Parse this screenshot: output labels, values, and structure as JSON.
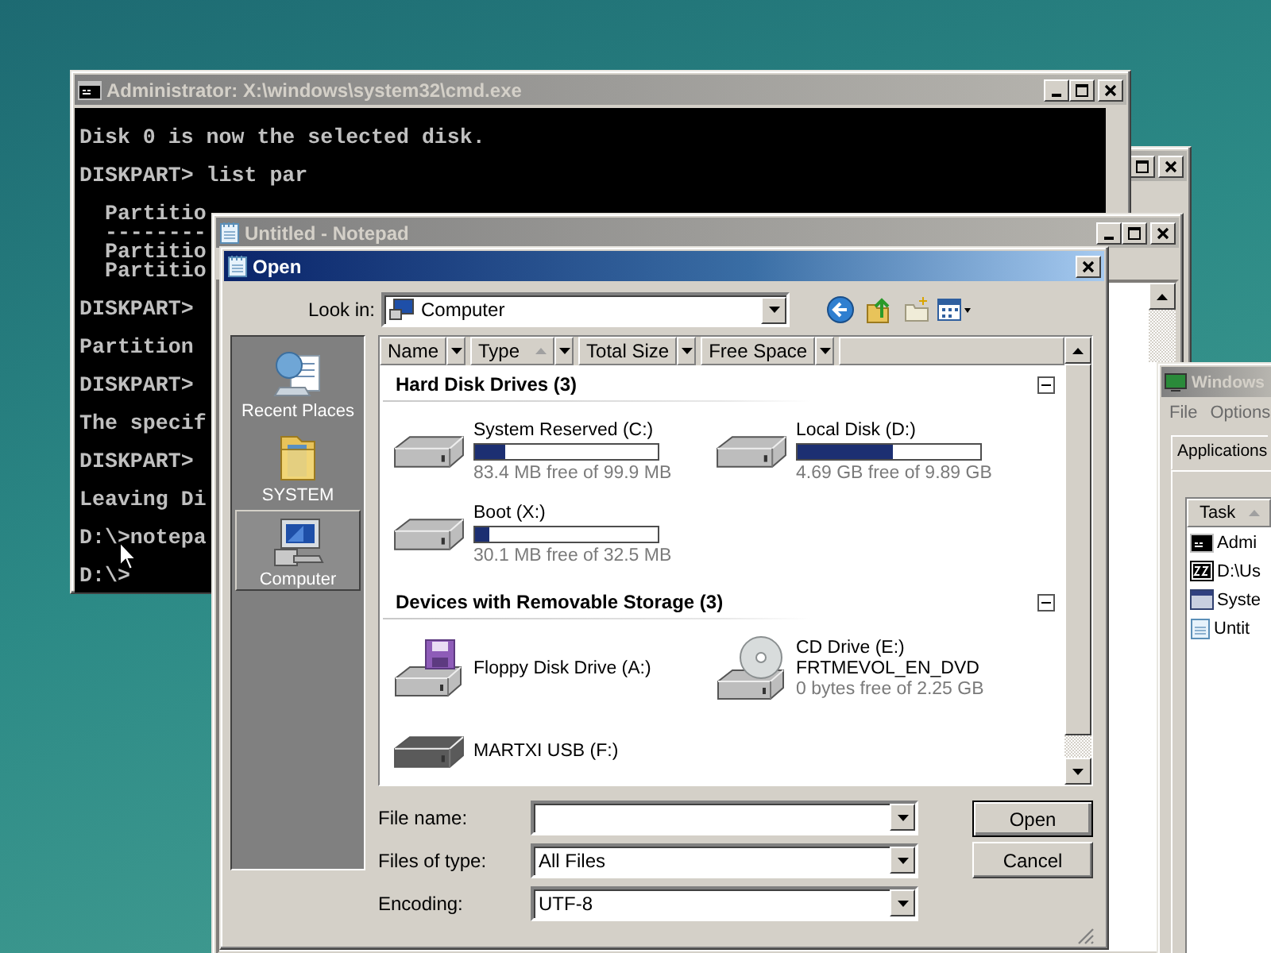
{
  "background_window": {
    "active": false
  },
  "console_window": {
    "title": "Administrator: X:\\windows\\system32\\cmd.exe",
    "active": false,
    "blocks": [
      [
        "Disk 0 is now the selected disk."
      ],
      [
        "DISKPART> list par"
      ],
      [
        "  Partitio",
        "  --------",
        "  Partitio",
        "  Partitio"
      ],
      [
        "DISKPART>"
      ],
      [
        "Partition"
      ],
      [
        "DISKPART>"
      ],
      [
        "The specif"
      ],
      [
        "DISKPART>"
      ],
      [
        "Leaving Di"
      ],
      [
        "D:\\>notepa"
      ],
      [
        "D:\\>"
      ]
    ]
  },
  "notepad_window": {
    "title": "Untitled - Notepad",
    "active": false
  },
  "open_dialog": {
    "title": "Open",
    "active": true,
    "look_in": {
      "label": "Look in:",
      "value": "Computer"
    },
    "places": [
      {
        "label": "Recent Places",
        "kind": "recent",
        "selected": false
      },
      {
        "label": "SYSTEM",
        "kind": "folder",
        "selected": false
      },
      {
        "label": "Computer",
        "kind": "computer",
        "selected": true
      }
    ],
    "columns": [
      {
        "label": "Name",
        "sorted": false
      },
      {
        "label": "Type",
        "sorted": true
      },
      {
        "label": "Total Size",
        "sorted": false
      },
      {
        "label": "Free Space",
        "sorted": false
      }
    ],
    "groups": [
      {
        "title": "Hard Disk Drives (3)",
        "expanded": true,
        "items": [
          {
            "kind": "hdd",
            "name": "System Reserved (C:)",
            "level": 0.165,
            "free": "83.4 MB free of 99.9 MB"
          },
          {
            "kind": "hdd",
            "name": "Local Disk (D:)",
            "level": 0.526,
            "free": "4.69 GB free of 9.89 GB"
          },
          {
            "kind": "hdd",
            "name": "Boot (X:)",
            "level": 0.074,
            "free": "30.1 MB free of 32.5 MB"
          }
        ]
      },
      {
        "title": "Devices with Removable Storage (3)",
        "expanded": true,
        "items": [
          {
            "kind": "floppy",
            "name": "Floppy Disk Drive (A:)"
          },
          {
            "kind": "cd",
            "name": "CD Drive (E:)",
            "label": "FRTMEVOL_EN_DVD",
            "free": "0 bytes free of 2.25 GB"
          },
          {
            "kind": "usb",
            "name": "MARTXI USB (F:)"
          }
        ]
      }
    ],
    "fields": [
      {
        "label": "File name:"
      },
      {
        "label": "Files of type:",
        "value": "All Files"
      },
      {
        "label": "Encoding:",
        "value": "UTF-8"
      }
    ],
    "buttons": [
      {
        "label": "Open",
        "default": true
      },
      {
        "label": "Cancel",
        "default": false
      }
    ]
  },
  "task_manager": {
    "title": "Windows",
    "active": false,
    "menu": [
      "File",
      "Options"
    ],
    "tabs": [
      {
        "label": "Applications",
        "selected": true
      }
    ],
    "column": "Task",
    "rows": [
      {
        "text": "Admi",
        "kind": "console"
      },
      {
        "text": "D:\\Us",
        "kind": "archive"
      },
      {
        "text": "Syste",
        "kind": "window"
      },
      {
        "text": "Untit",
        "kind": "notepad"
      }
    ]
  }
}
